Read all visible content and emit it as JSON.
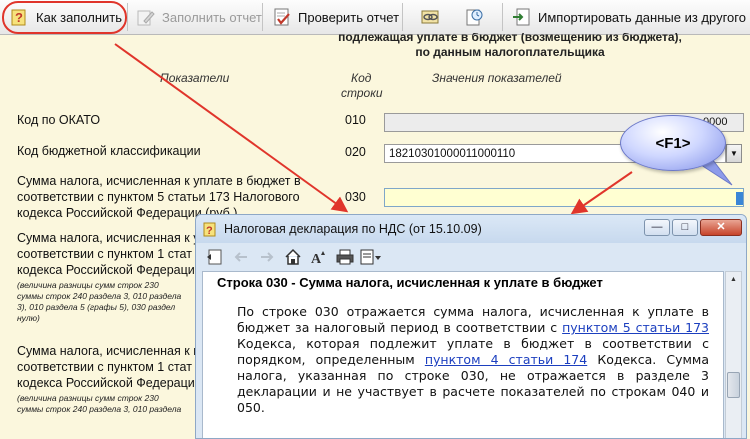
{
  "toolbar": {
    "how_to_fill": "Как заполнить",
    "fill_report": "Заполнить отчет",
    "check_report": "Проверить отчет",
    "import_data": "Импортировать данные из другого от"
  },
  "form": {
    "title_top": "подлежащая уплате в бюджет (возмещению из бюджета),",
    "title_bottom": "по данным налогоплательщика",
    "col_indicators": "Показатели",
    "col_code_line1": "Код",
    "col_code_line2": "строки",
    "col_values": "Значения показателей",
    "rows": [
      {
        "label": "Код по ОКАТО",
        "code": "010",
        "value": ""
      },
      {
        "label": "Код бюджетной классификации",
        "code": "020",
        "value": "18210301000011000110"
      },
      {
        "label_lines": [
          "Сумма налога, исчисленная к уплате в бюджет в",
          "соответствии с пунктом 5 статьи 173 Налогового",
          "кодекса Российской Федерации (руб.)"
        ],
        "code": "030",
        "value": ""
      },
      {
        "label_lines": [
          "Сумма налога, исчисленная к у",
          "соответствии с пунктом 1 стат",
          "кодекса Российской Федераци"
        ],
        "note_lines": [
          "(величина разницы сумм строк 230",
          "суммы строк 240 раздела 3, 010 раздела",
          "3), 010 раздела 5 (графы 5), 030 раздел",
          "нулю)"
        ]
      },
      {
        "label_lines": [
          "Сумма налога, исчисленная к в",
          "соответствии с пунктом 1 стат",
          "кодекса Российской Федераци"
        ],
        "note_lines": [
          "(величина разницы сумм строк 230",
          "суммы строк 240 раздела 3, 010 раздела"
        ]
      }
    ],
    "okato_clip": "0000"
  },
  "callout": {
    "text": "<F1>"
  },
  "help_window": {
    "title": "Налоговая декларация по НДС (от 15.10.09)",
    "heading": "Строка 030 - Сумма налога, исчисленная к уплате в бюджет",
    "para_1": "По строке 030 отражается сумма налога, исчисленная к уплате в бюджет за налоговый период в соответствии с ",
    "link_1": "пунктом 5 статьи 173",
    "para_2": " Кодекса, которая подлежит уплате в бюджет в соответствии с порядком, определенным ",
    "link_2": "пунктом 4 статьи 174",
    "para_3": " Кодекса. Сумма налога, указанная по строке 030, не отражается в разделе 3 декларации и не участвует в расчете показателей по строкам 040 и 050."
  },
  "colors": {
    "highlight": "#e0352b",
    "form_bg": "#fbf7dd",
    "link": "#1c3fbf"
  }
}
